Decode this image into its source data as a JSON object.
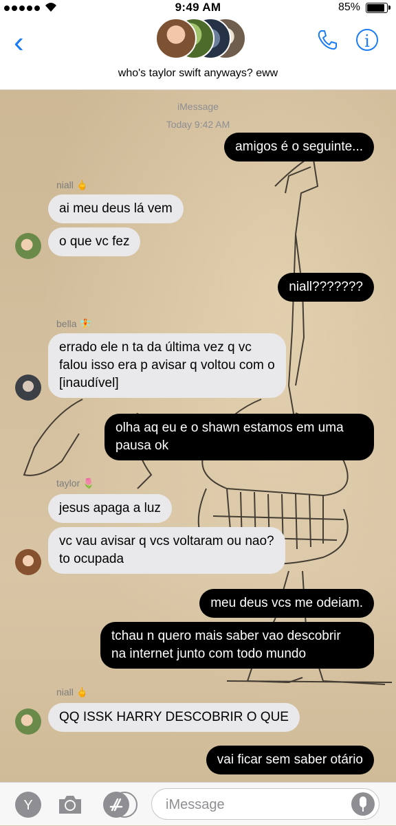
{
  "status": {
    "time": "9:49 AM",
    "battery": "85%"
  },
  "header": {
    "title": "who's taylor swift anyways? eww",
    "back_glyph": "‹",
    "info_glyph": "i"
  },
  "thread": {
    "service": "iMessage",
    "timestamp": "Today 9:42 AM",
    "messages": [
      {
        "from": "me",
        "text": "amigos é o seguinte..."
      },
      {
        "sender": "niall",
        "sender_emoji": "🖕",
        "text": "ai meu deus lá vem"
      },
      {
        "sender": "niall",
        "text": "o que vc fez"
      },
      {
        "from": "me",
        "text": "niall???????"
      },
      {
        "sender": "bella",
        "sender_emoji": "🧚",
        "text": "errado ele n ta da última vez q vc\nfalou isso era p avisar q voltou com o\n[inaudível]"
      },
      {
        "from": "me",
        "text": "olha aq eu e o shawn estamos em uma\npausa ok"
      },
      {
        "sender": "taylor",
        "sender_emoji": "🌷",
        "text": "jesus apaga a luz"
      },
      {
        "sender": "taylor",
        "text": "vc vau avisar q vcs voltaram ou nao?\nto ocupada"
      },
      {
        "from": "me",
        "text": "meu deus vcs me odeiam."
      },
      {
        "from": "me",
        "text": "tchau n quero mais saber vao descobrir\nna internet junto com todo mundo"
      },
      {
        "sender": "niall",
        "sender_emoji": "🖕",
        "text": "QQ ISSK HARRY DESCOBRIR O QUE"
      },
      {
        "from": "me",
        "text": "vai ficar sem saber otário"
      }
    ]
  },
  "composer": {
    "apps_label": "Y",
    "placeholder": "iMessage"
  }
}
